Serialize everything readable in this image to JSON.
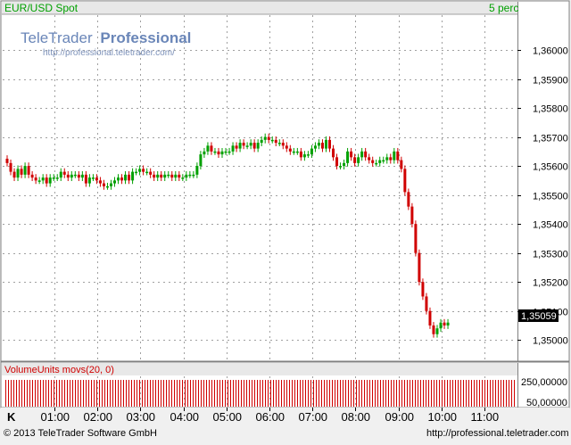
{
  "header": {
    "instrument": "EUR/USD Spot",
    "interval": "5 perc"
  },
  "watermark": {
    "brand_light": "TeleTrader",
    "brand_bold": "Professional",
    "url": "http://professional.teletrader.com/"
  },
  "volume": {
    "title": "VolumeUnits movs(20, 0)",
    "ticks": [
      "250,00000",
      "50,00000"
    ]
  },
  "footer": {
    "axis_mode": "K",
    "copyright": "© 2013 TeleTrader Software GmbH",
    "url": "http://professional.teletrader.com"
  },
  "colors": {
    "up": "#00a000",
    "down": "#d00000",
    "grid": "#a0a0a0",
    "label_bg": "#000000"
  },
  "chart_data": {
    "type": "candlestick",
    "title": "EUR/USD Spot",
    "interval": "5 perc",
    "x_ticks": [
      "01:00",
      "02:00",
      "03:00",
      "04:00",
      "05:00",
      "06:00",
      "07:00",
      "08:00",
      "09:00",
      "10:00",
      "11:00"
    ],
    "y_ticks": [
      "1,36000",
      "1,35900",
      "1,35800",
      "1,35700",
      "1,35600",
      "1,35500",
      "1,35400",
      "1,35300",
      "1,35200",
      "1,35100",
      "1,35000"
    ],
    "ylim": [
      1.3493,
      1.3612
    ],
    "last_value": "1,35059",
    "closes": [
      1.3561,
      1.3558,
      1.3556,
      1.3559,
      1.3557,
      1.356,
      1.3557,
      1.3556,
      1.3555,
      1.3555,
      1.3556,
      1.3554,
      1.3556,
      1.3556,
      1.3556,
      1.3558,
      1.3557,
      1.3556,
      1.3557,
      1.3557,
      1.3556,
      1.3557,
      1.3554,
      1.3556,
      1.3556,
      1.3555,
      1.3554,
      1.3553,
      1.3553,
      1.3554,
      1.3555,
      1.3556,
      1.3555,
      1.3557,
      1.3555,
      1.3558,
      1.3558,
      1.3559,
      1.3558,
      1.3558,
      1.3557,
      1.3556,
      1.3557,
      1.3556,
      1.3557,
      1.3557,
      1.3556,
      1.3557,
      1.3556,
      1.3556,
      1.3557,
      1.3557,
      1.3557,
      1.356,
      1.3564,
      1.3565,
      1.3567,
      1.3565,
      1.3565,
      1.3564,
      1.3565,
      1.3565,
      1.3565,
      1.3567,
      1.3566,
      1.3568,
      1.3567,
      1.3567,
      1.3568,
      1.3566,
      1.3568,
      1.3569,
      1.357,
      1.3569,
      1.3569,
      1.3568,
      1.3568,
      1.3567,
      1.3566,
      1.3565,
      1.3565,
      1.3565,
      1.3563,
      1.3564,
      1.3564,
      1.3566,
      1.3567,
      1.3568,
      1.3566,
      1.3569,
      1.3566,
      1.3563,
      1.356,
      1.356,
      1.3561,
      1.3565,
      1.3563,
      1.3561,
      1.3563,
      1.3565,
      1.3563,
      1.3562,
      1.3561,
      1.3561,
      1.3562,
      1.3562,
      1.3563,
      1.3562,
      1.3565,
      1.3562,
      1.3559,
      1.3551,
      1.3546,
      1.354,
      1.353,
      1.352,
      1.3515,
      1.351,
      1.3505,
      1.3502,
      1.3504,
      1.3506,
      1.3505,
      1.3506
    ],
    "volume_ticks": [
      "250,00000",
      "50,00000"
    ]
  }
}
